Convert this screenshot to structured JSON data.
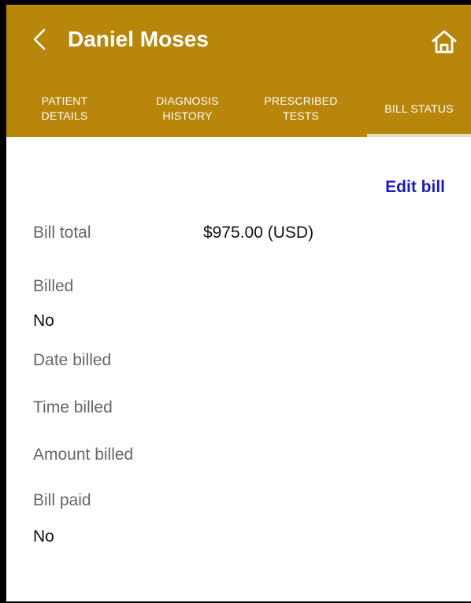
{
  "header": {
    "title": "Daniel Moses",
    "background_color": "#b8860b",
    "back_icon": "chevron-left-icon",
    "home_icon": "home-icon"
  },
  "tabs": [
    {
      "label": "PATIENT\nDETAILS",
      "active": false
    },
    {
      "label": "DIAGNOSIS\nHISTORY",
      "active": false
    },
    {
      "label": "PRESCRIBED\nTESTS",
      "active": false
    },
    {
      "label": "BILL STATUS",
      "active": true
    }
  ],
  "actions": {
    "edit_bill": "Edit bill",
    "edit_bill_color": "#1a1ac8"
  },
  "bill": {
    "total_label": "Bill total",
    "total_value": "$975.00 (USD)",
    "billed_label": "Billed",
    "billed_value": "No",
    "date_billed_label": "Date billed",
    "date_billed_value": "",
    "time_billed_label": "Time billed",
    "time_billed_value": "",
    "amount_billed_label": "Amount billed",
    "amount_billed_value": "",
    "bill_paid_label": "Bill paid",
    "bill_paid_value": "No"
  }
}
